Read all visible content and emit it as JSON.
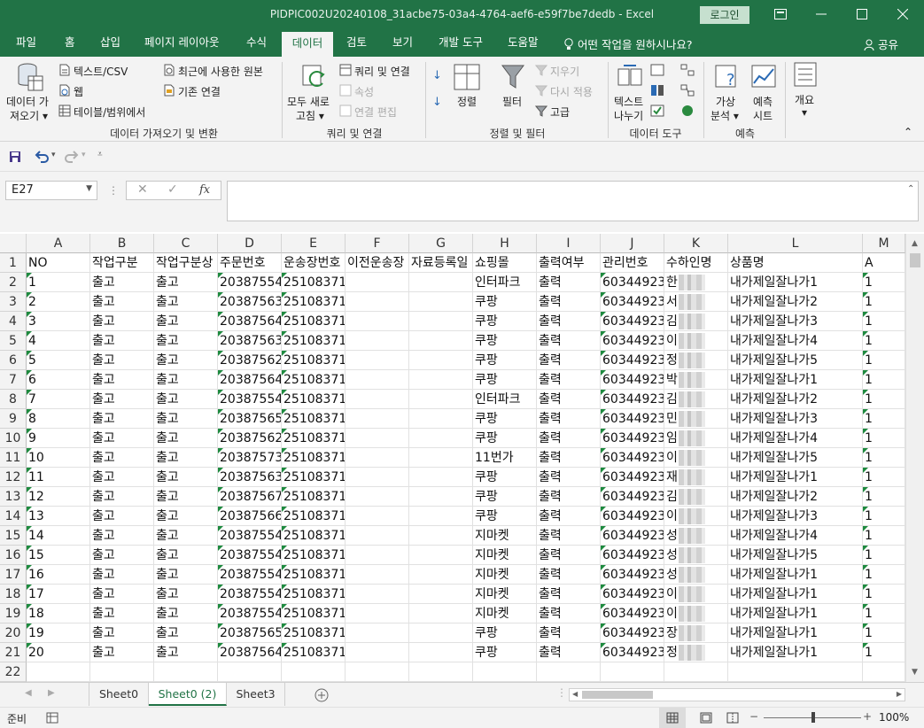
{
  "window": {
    "title": "PIDPIC002U20240108_31acbe75-03a4-4764-aef6-e59f7be7dedb  -  Excel",
    "login": "로그인",
    "ribbon_display_icon": "ribbon-display-icon",
    "minimize_icon": "minimize-icon",
    "restore_icon": "restore-icon",
    "close_icon": "close-icon"
  },
  "tabs": [
    "파일",
    "홈",
    "삽입",
    "페이지 레이아웃",
    "수식",
    "데이터",
    "검토",
    "보기",
    "개발 도구",
    "도움말"
  ],
  "active_tab": "데이터",
  "tell_me": "어떤 작업을 원하시나요?",
  "share": "공유",
  "ribbon": {
    "get_data_label": "데이터 가",
    "get_data_label2": "져오기",
    "from_text_csv": "텍스트/CSV",
    "from_web": "웹",
    "from_table_range": "테이블/범위에서",
    "recent_sources": "최근에 사용한 원본",
    "existing_connections": "기존 연결",
    "group_get_transform": "데이터 가져오기 및 변환",
    "refresh_all": "모두 새로",
    "refresh_all2": "고침",
    "queries_connections": "쿼리 및 연결",
    "properties": "속성",
    "edit_links": "연결 편집",
    "group_queries": "쿼리 및 연결",
    "sort": "정렬",
    "filter": "필터",
    "clear": "지우기",
    "reapply": "다시 적용",
    "advanced": "고급",
    "group_sort_filter": "정렬 및 필터",
    "text_to_columns": "텍스트",
    "text_to_columns2": "나누기",
    "group_data_tools": "데이터 도구",
    "what_if": "가상",
    "what_if2": "분석",
    "forecast_sheet": "예측",
    "forecast_sheet2": "시트",
    "group_forecast": "예측",
    "outline": "개요"
  },
  "formula_bar": {
    "name_box": "E27",
    "formula": ""
  },
  "columns": [
    "A",
    "B",
    "C",
    "D",
    "E",
    "F",
    "G",
    "H",
    "I",
    "J",
    "K",
    "L",
    "M"
  ],
  "header_row": [
    "NO",
    "작업구분",
    "작업구분상",
    "주문번호",
    "운송장번호",
    "이전운송장",
    "자료등록일",
    "쇼핑몰",
    "출력여부",
    "관리번호",
    "수하인명",
    "상품명",
    "A"
  ],
  "rows": [
    [
      "1",
      "출고",
      "출고",
      "20387554",
      "25108371",
      "",
      "",
      "인터파크",
      "출력",
      "60344923",
      "한",
      "내가제일잘나가1",
      "1"
    ],
    [
      "2",
      "출고",
      "출고",
      "20387563",
      "25108371",
      "",
      "",
      "쿠팡",
      "출력",
      "60344923",
      "서",
      "내가제일잘나가2",
      "1"
    ],
    [
      "3",
      "출고",
      "출고",
      "20387564",
      "25108371",
      "",
      "",
      "쿠팡",
      "출력",
      "60344923",
      "김",
      "내가제일잘나가3",
      "1"
    ],
    [
      "4",
      "출고",
      "출고",
      "20387563",
      "25108371",
      "",
      "",
      "쿠팡",
      "출력",
      "60344923",
      "이",
      "내가제일잘나가4",
      "1"
    ],
    [
      "5",
      "출고",
      "출고",
      "20387562",
      "25108371",
      "",
      "",
      "쿠팡",
      "출력",
      "60344923",
      "정",
      "내가제일잘나가5",
      "1"
    ],
    [
      "6",
      "출고",
      "출고",
      "20387564",
      "25108371",
      "",
      "",
      "쿠팡",
      "출력",
      "60344923",
      "박",
      "내가제일잘나가1",
      "1"
    ],
    [
      "7",
      "출고",
      "출고",
      "20387554",
      "25108371",
      "",
      "",
      "인터파크",
      "출력",
      "60344923",
      "김",
      "내가제일잘나가2",
      "1"
    ],
    [
      "8",
      "출고",
      "출고",
      "20387565",
      "25108371",
      "",
      "",
      "쿠팡",
      "출력",
      "60344923",
      "민",
      "내가제일잘나가3",
      "1"
    ],
    [
      "9",
      "출고",
      "출고",
      "20387562",
      "25108371",
      "",
      "",
      "쿠팡",
      "출력",
      "60344923",
      "임",
      "내가제일잘나가4",
      "1"
    ],
    [
      "10",
      "출고",
      "출고",
      "20387573",
      "25108371",
      "",
      "",
      "11번가",
      "출력",
      "60344923",
      "이",
      "내가제일잘나가5",
      "1"
    ],
    [
      "11",
      "출고",
      "출고",
      "20387563",
      "25108371",
      "",
      "",
      "쿠팡",
      "출력",
      "60344923",
      "재",
      "내가제일잘나가1",
      "1"
    ],
    [
      "12",
      "출고",
      "출고",
      "20387567",
      "25108371",
      "",
      "",
      "쿠팡",
      "출력",
      "60344923",
      "김",
      "내가제일잘나가2",
      "1"
    ],
    [
      "13",
      "출고",
      "출고",
      "20387566",
      "25108371",
      "",
      "",
      "쿠팡",
      "출력",
      "60344923",
      "이",
      "내가제일잘나가3",
      "1"
    ],
    [
      "14",
      "출고",
      "출고",
      "20387554",
      "25108371",
      "",
      "",
      "지마켓",
      "출력",
      "60344923",
      "성",
      "내가제일잘나가4",
      "1"
    ],
    [
      "15",
      "출고",
      "출고",
      "20387554",
      "25108371",
      "",
      "",
      "지마켓",
      "출력",
      "60344923",
      "성",
      "내가제일잘나가5",
      "1"
    ],
    [
      "16",
      "출고",
      "출고",
      "20387554",
      "25108371",
      "",
      "",
      "지마켓",
      "출력",
      "60344923",
      "성",
      "내가제일잘나가1",
      "1"
    ],
    [
      "17",
      "출고",
      "출고",
      "20387554",
      "25108371",
      "",
      "",
      "지마켓",
      "출력",
      "60344923",
      "이",
      "내가제일잘나가1",
      "1"
    ],
    [
      "18",
      "출고",
      "출고",
      "20387554",
      "25108371",
      "",
      "",
      "지마켓",
      "출력",
      "60344923",
      "이",
      "내가제일잘나가1",
      "1"
    ],
    [
      "19",
      "출고",
      "출고",
      "20387565",
      "25108371",
      "",
      "",
      "쿠팡",
      "출력",
      "60344923",
      "장",
      "내가제일잘나가1",
      "1"
    ],
    [
      "20",
      "출고",
      "출고",
      "20387564",
      "25108371",
      "",
      "",
      "쿠팡",
      "출력",
      "60344923",
      "정",
      "내가제일잘나가1",
      "1"
    ]
  ],
  "row_numbers": [
    "1",
    "2",
    "3",
    "4",
    "5",
    "6",
    "7",
    "8",
    "9",
    "10",
    "11",
    "12",
    "13",
    "14",
    "15",
    "16",
    "17",
    "18",
    "19",
    "20",
    "21",
    "22"
  ],
  "sheets": [
    "Sheet0",
    "Sheet0 (2)",
    "Sheet3"
  ],
  "active_sheet": "Sheet0 (2)",
  "status": {
    "ready": "준비",
    "zoom": "100%"
  },
  "colors": {
    "excel_green": "#217346",
    "triangle_green": "#1e8a3f"
  }
}
